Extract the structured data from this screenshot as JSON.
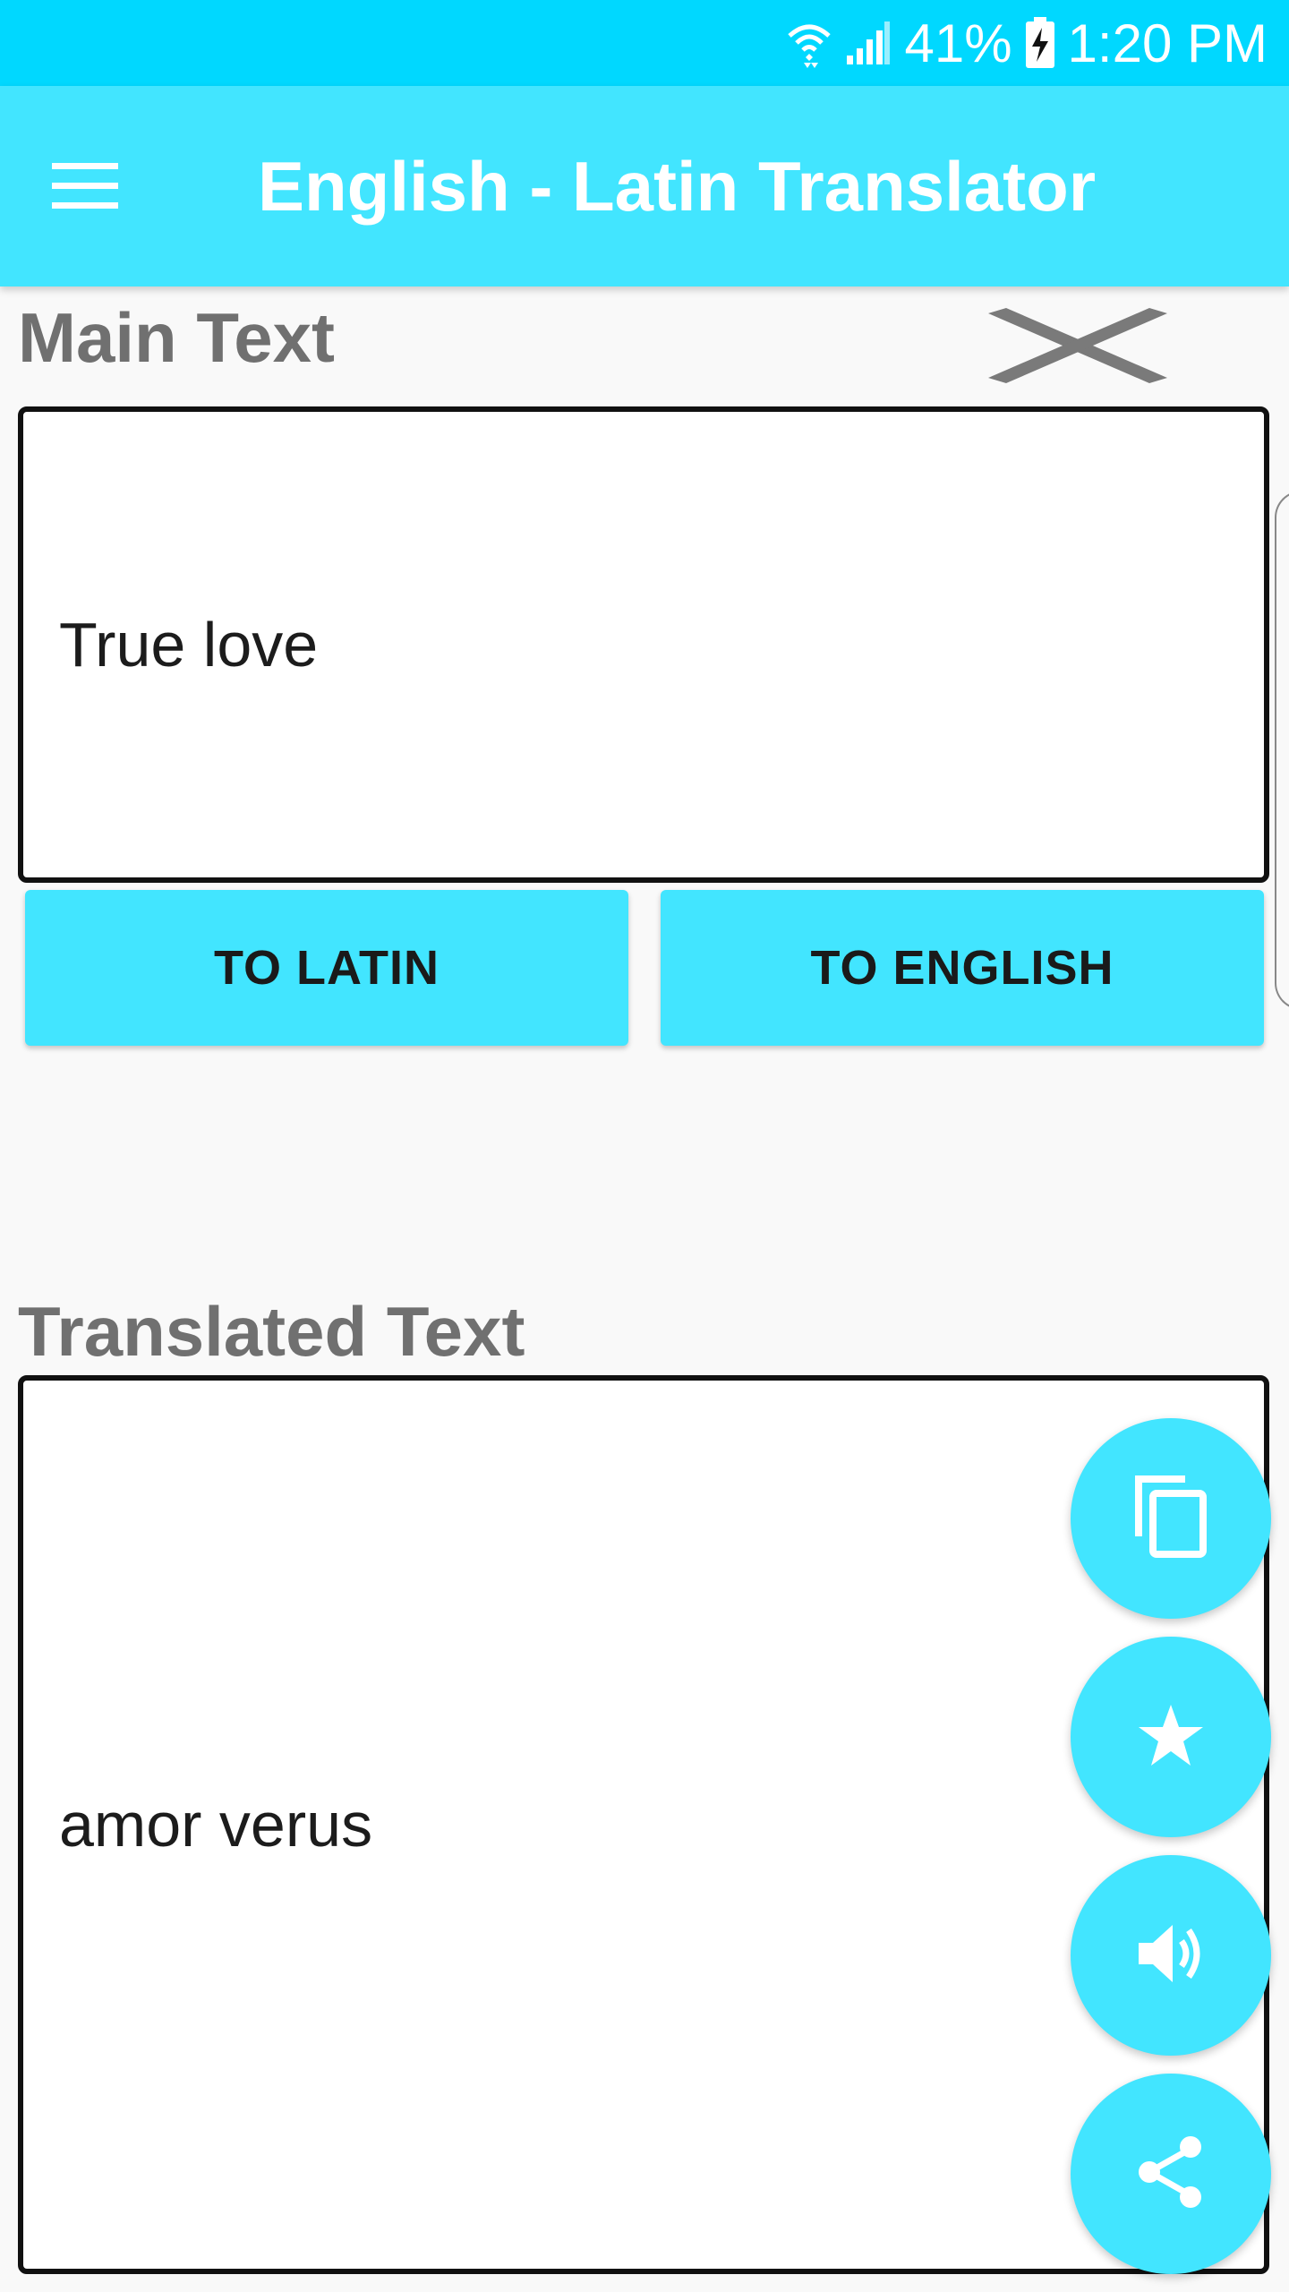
{
  "status_bar": {
    "battery_percent": "41%",
    "time": "1:20 PM",
    "icons": [
      "wifi-icon",
      "signal-icon",
      "battery-charging-icon"
    ]
  },
  "app_bar": {
    "title": "English - Latin Translator",
    "menu_icon": "hamburger-menu-icon"
  },
  "main_section": {
    "label": "Main Text",
    "input_value": "True love",
    "clear_icon": "clear-icon"
  },
  "buttons": {
    "to_latin": "TO LATIN",
    "to_english": "TO ENGLISH"
  },
  "translated_section": {
    "label": "Translated Text",
    "output_value": "amor verus"
  },
  "fabs": [
    "copy-icon",
    "star-icon",
    "speaker-icon",
    "share-icon"
  ],
  "colors": {
    "status_bar": "#00d8ff",
    "accent": "#42e5ff",
    "label_gray": "#707070",
    "box_border": "#111111"
  }
}
